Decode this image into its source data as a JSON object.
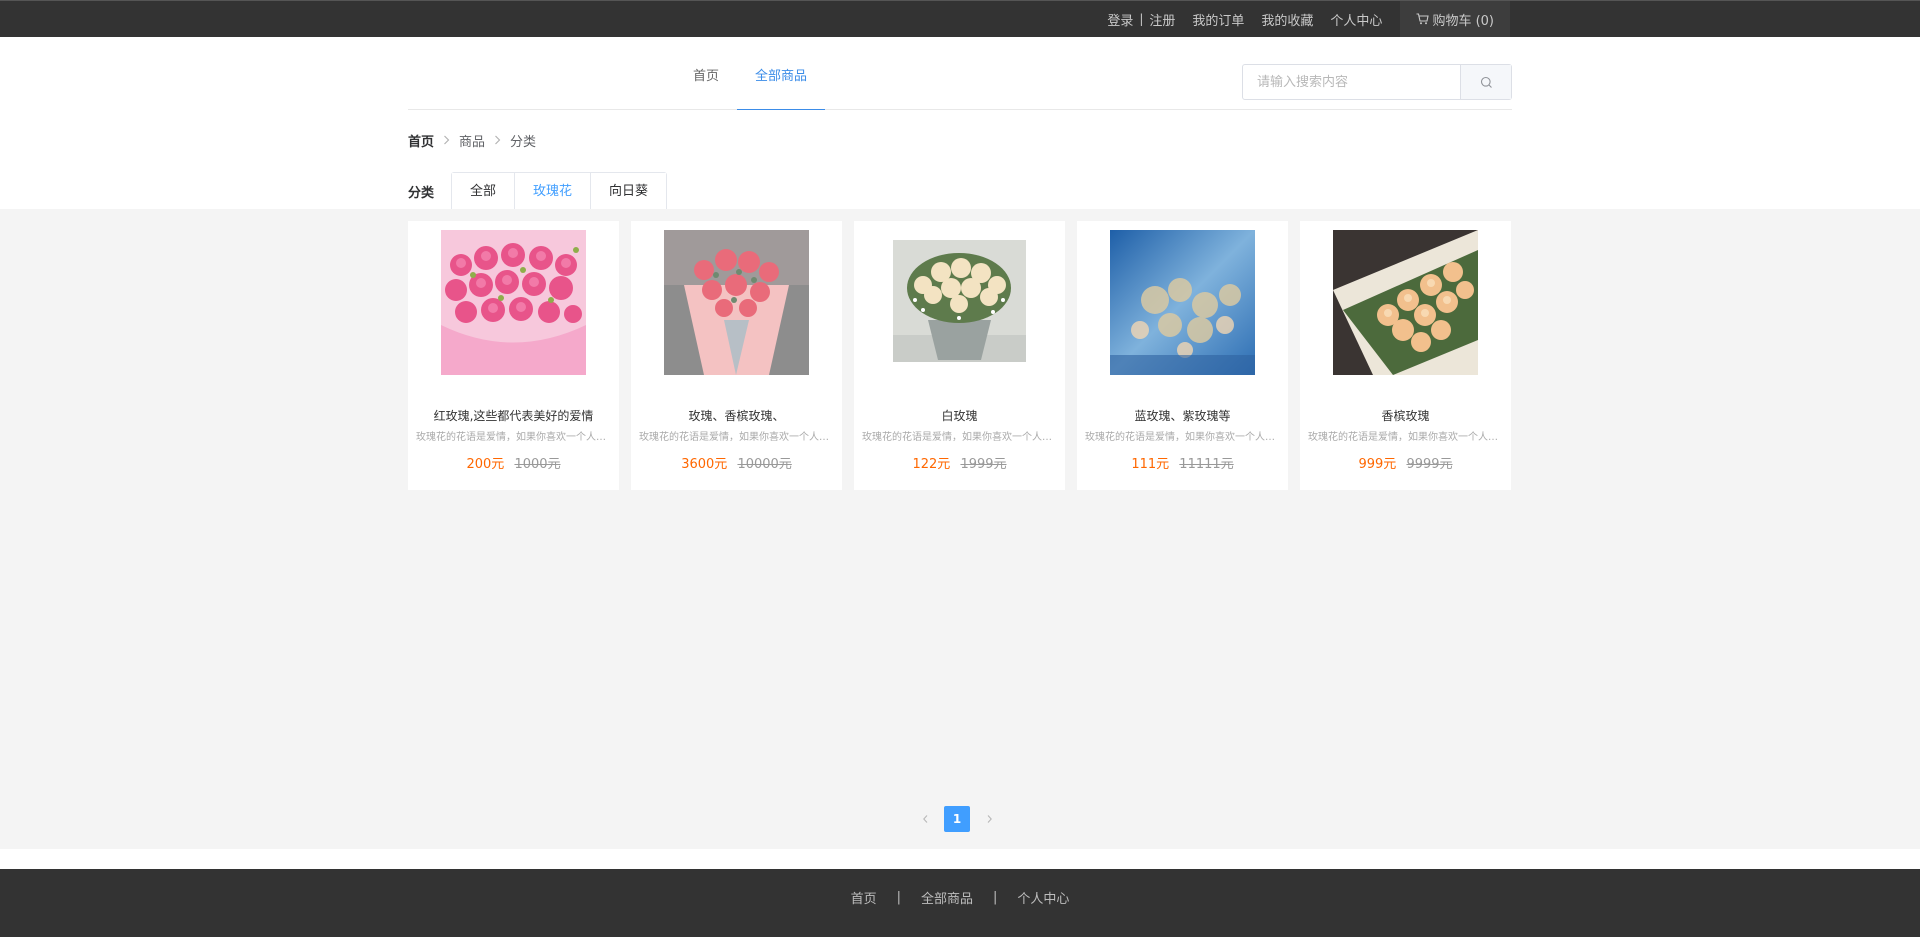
{
  "topbar": {
    "login": "登录",
    "separator": "|",
    "register": "注册",
    "orders": "我的订单",
    "favorites": "我的收藏",
    "profile": "个人中心",
    "cart": "购物车 (0)"
  },
  "nav": {
    "items": [
      {
        "label": "首页"
      },
      {
        "label": "全部商品"
      }
    ]
  },
  "search": {
    "placeholder": "请输入搜索内容",
    "value": ""
  },
  "breadcrumb": {
    "items": [
      "首页",
      "商品",
      "分类"
    ]
  },
  "category": {
    "label": "分类",
    "tabs": [
      "全部",
      "玫瑰花",
      "向日葵"
    ],
    "active": "玫瑰花"
  },
  "products": [
    {
      "name": "红玫瑰,这些都代表美好的爱情",
      "desc": "玫瑰花的花语是爱情，如果你喜欢一个人，就可以送她玫瑰花",
      "price": "200元",
      "old_price": "1000元"
    },
    {
      "name": "玫瑰、香槟玫瑰、",
      "desc": "玫瑰花的花语是爱情，如果你喜欢一个人，就可以送她玫瑰花",
      "price": "3600元",
      "old_price": "10000元"
    },
    {
      "name": "白玫瑰",
      "desc": "玫瑰花的花语是爱情，如果你喜欢一个人，就可以送她玫瑰花",
      "price": "122元",
      "old_price": "1999元"
    },
    {
      "name": "蓝玫瑰、紫玫瑰等",
      "desc": "玫瑰花的花语是爱情，如果你喜欢一个人，就可以送她玫瑰花",
      "price": "111元",
      "old_price": "11111元"
    },
    {
      "name": "香槟玫瑰",
      "desc": "玫瑰花的花语是爱情，如果你喜欢一个人，就可以送她玫瑰花",
      "price": "999元",
      "old_price": "9999元"
    }
  ],
  "pagination": {
    "current": "1"
  },
  "footer": {
    "links": [
      "首页",
      "全部商品",
      "个人中心"
    ],
    "separator": "|"
  },
  "colors": {
    "accent": "#409eff",
    "nav_active": "#3b8ce8",
    "price": "#ff6700",
    "topbar_bg": "#333333",
    "main_bg": "#f4f4f4"
  }
}
